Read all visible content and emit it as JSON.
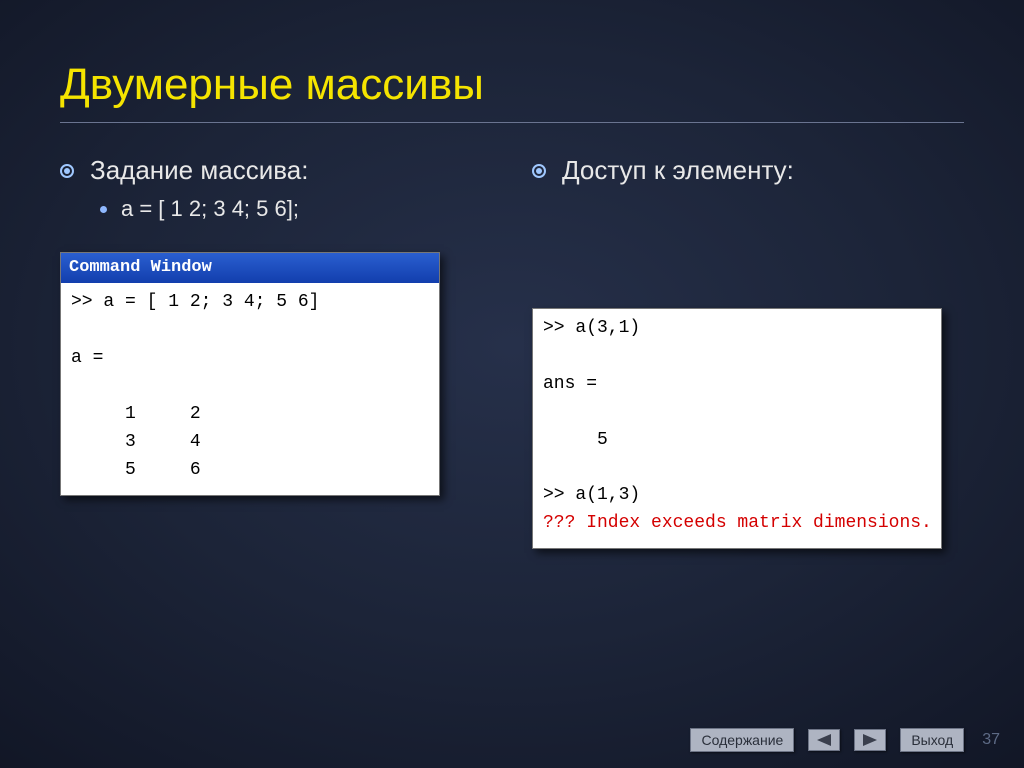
{
  "title": "Двумерные массивы",
  "left": {
    "heading": "Задание массива:",
    "code_example": "a = [ 1 2; 3 4; 5 6];",
    "window_title": "Command Window",
    "terminal": ">> a = [ 1 2; 3 4; 5 6]\n\na =\n\n     1     2\n     3     4\n     5     6"
  },
  "right": {
    "heading": "Доступ к элементу:",
    "terminal_plain": ">> a(3,1)\n\nans =\n\n     5\n\n>> a(1,3)",
    "terminal_error": "??? Index exceeds matrix dimensions."
  },
  "footer": {
    "contents": "Содержание",
    "exit": "Выход"
  },
  "page_number": "37"
}
